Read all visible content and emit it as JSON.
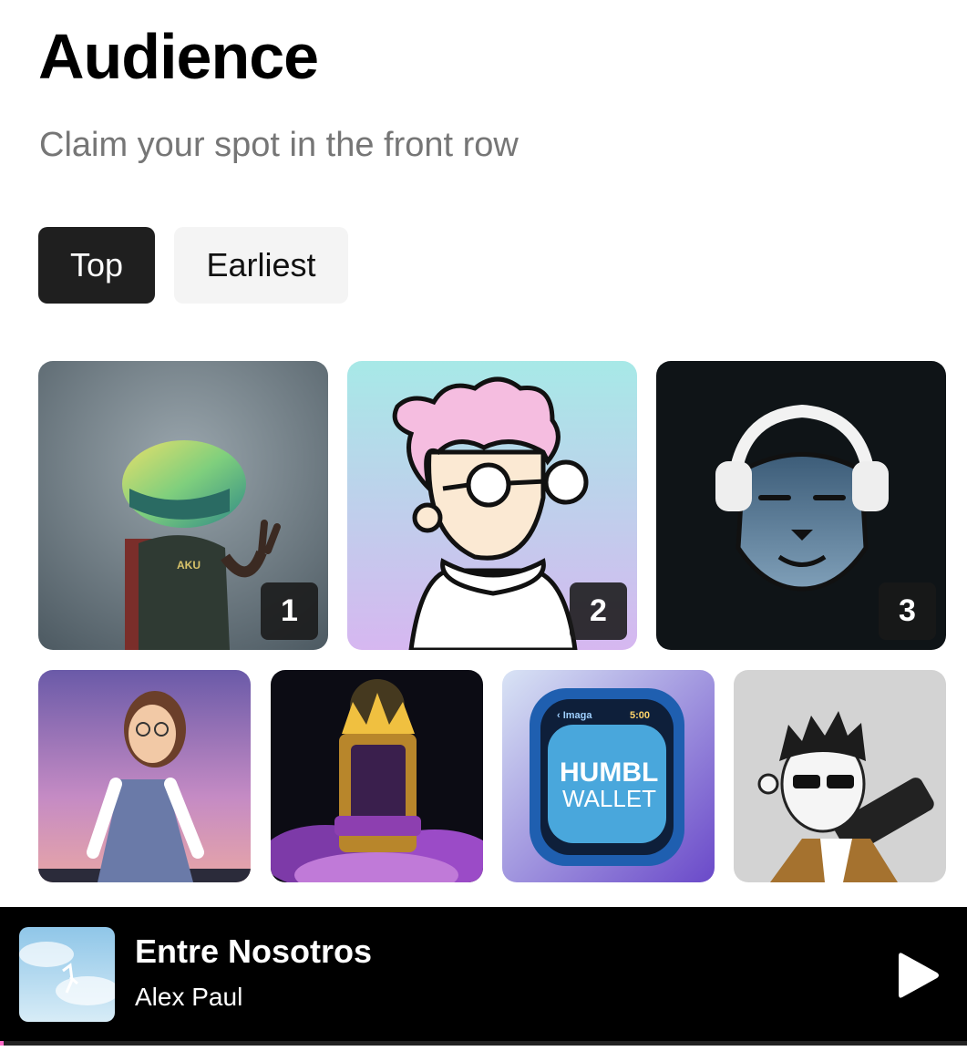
{
  "header": {
    "title": "Audience",
    "subtitle": "Claim your spot in the front row"
  },
  "filters": [
    {
      "label": "Top",
      "selected": true
    },
    {
      "label": "Earliest",
      "selected": false
    }
  ],
  "audience": {
    "top": [
      {
        "rank": "1",
        "avatar": "helmet-character-avatar"
      },
      {
        "rank": "2",
        "avatar": "pink-hair-glasses-avatar"
      },
      {
        "rank": "3",
        "avatar": "headphones-ape-avatar"
      }
    ],
    "others": [
      {
        "avatar": "3d-girl-avatar"
      },
      {
        "avatar": "golden-throne-avatar"
      },
      {
        "avatar": "smartwatch-wallet-avatar",
        "text_line1": "HUMBL",
        "text_line2": "WALLET"
      },
      {
        "avatar": "sunglasses-keyboard-avatar"
      }
    ]
  },
  "player": {
    "title": "Entre Nosotros",
    "artist": "Alex Paul",
    "play_icon": "play-icon",
    "progress": 0.002,
    "colors": {
      "progress": "#ff69c8",
      "background": "#000000"
    }
  }
}
